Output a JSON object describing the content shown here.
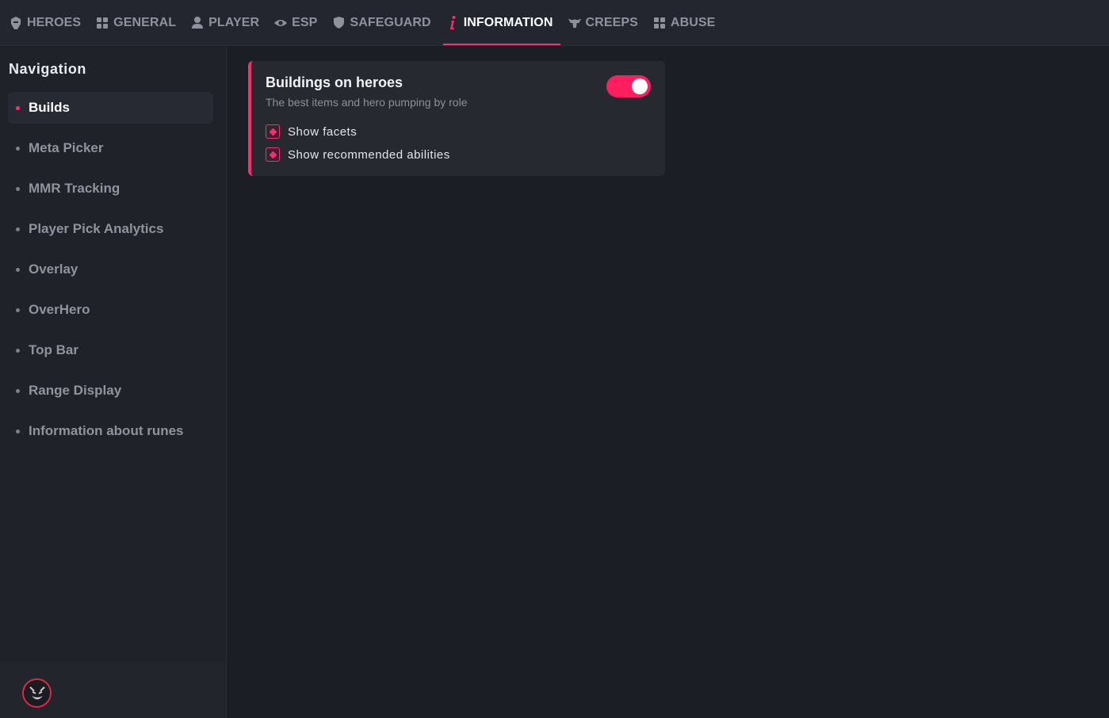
{
  "tabs": [
    {
      "label": "HEROES",
      "icon": "helmet-icon"
    },
    {
      "label": "GENERAL",
      "icon": "grid-icon"
    },
    {
      "label": "PLAYER",
      "icon": "user-icon"
    },
    {
      "label": "ESP",
      "icon": "eye-icon"
    },
    {
      "label": "SAFEGUARD",
      "icon": "shield-icon"
    },
    {
      "label": "INFORMATION",
      "icon": "info-icon",
      "active": true
    },
    {
      "label": "CREEPS",
      "icon": "creep-icon"
    },
    {
      "label": "ABUSE",
      "icon": "grid-icon"
    }
  ],
  "sidebar": {
    "title": "Navigation",
    "items": [
      {
        "label": "Builds",
        "active": true
      },
      {
        "label": "Meta Picker"
      },
      {
        "label": "MMR Tracking"
      },
      {
        "label": "Player Pick Analytics"
      },
      {
        "label": "Overlay"
      },
      {
        "label": "OverHero"
      },
      {
        "label": "Top Bar"
      },
      {
        "label": "Range Display"
      },
      {
        "label": "Information about runes"
      }
    ]
  },
  "card": {
    "title": "Buildings on heroes",
    "subtitle": "The best items and hero pumping by role",
    "enabled": true,
    "options": [
      {
        "label": "Show facets",
        "checked": true
      },
      {
        "label": "Show recommended abilities",
        "checked": true
      }
    ]
  },
  "colors": {
    "accent": "#ff2d6b",
    "background": "#1b1e25",
    "panel": "#262930"
  }
}
